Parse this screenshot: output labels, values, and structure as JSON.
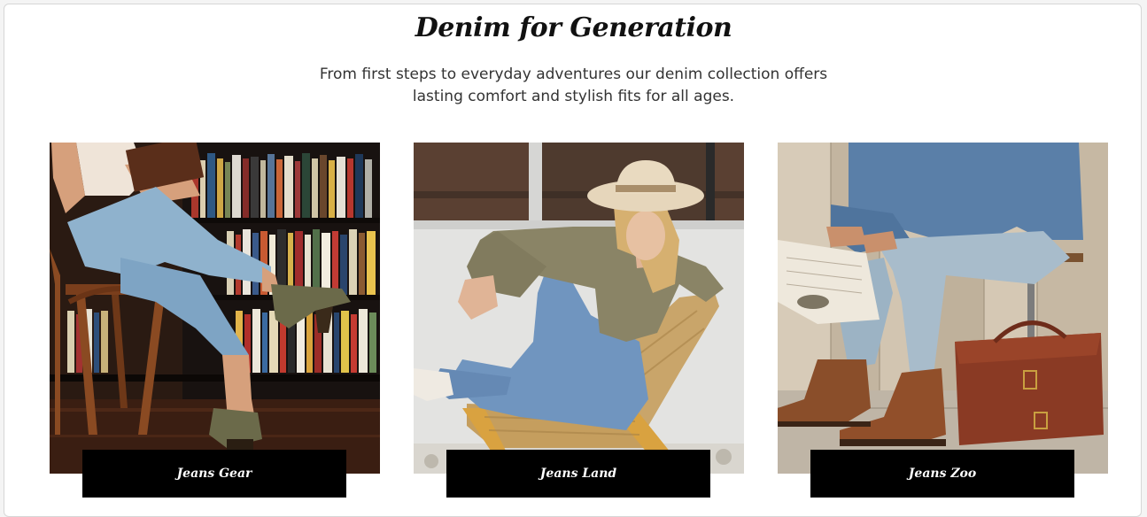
{
  "section": {
    "title": "Denim for Generation",
    "subtitle_line1": "From first steps to everyday adventures our denim collection offers",
    "subtitle_line2": "lasting comfort and stylish fits for all ages."
  },
  "cards": [
    {
      "label": "Jeans Gear"
    },
    {
      "label": "Jeans Land"
    },
    {
      "label": "Jeans Zoo"
    }
  ]
}
